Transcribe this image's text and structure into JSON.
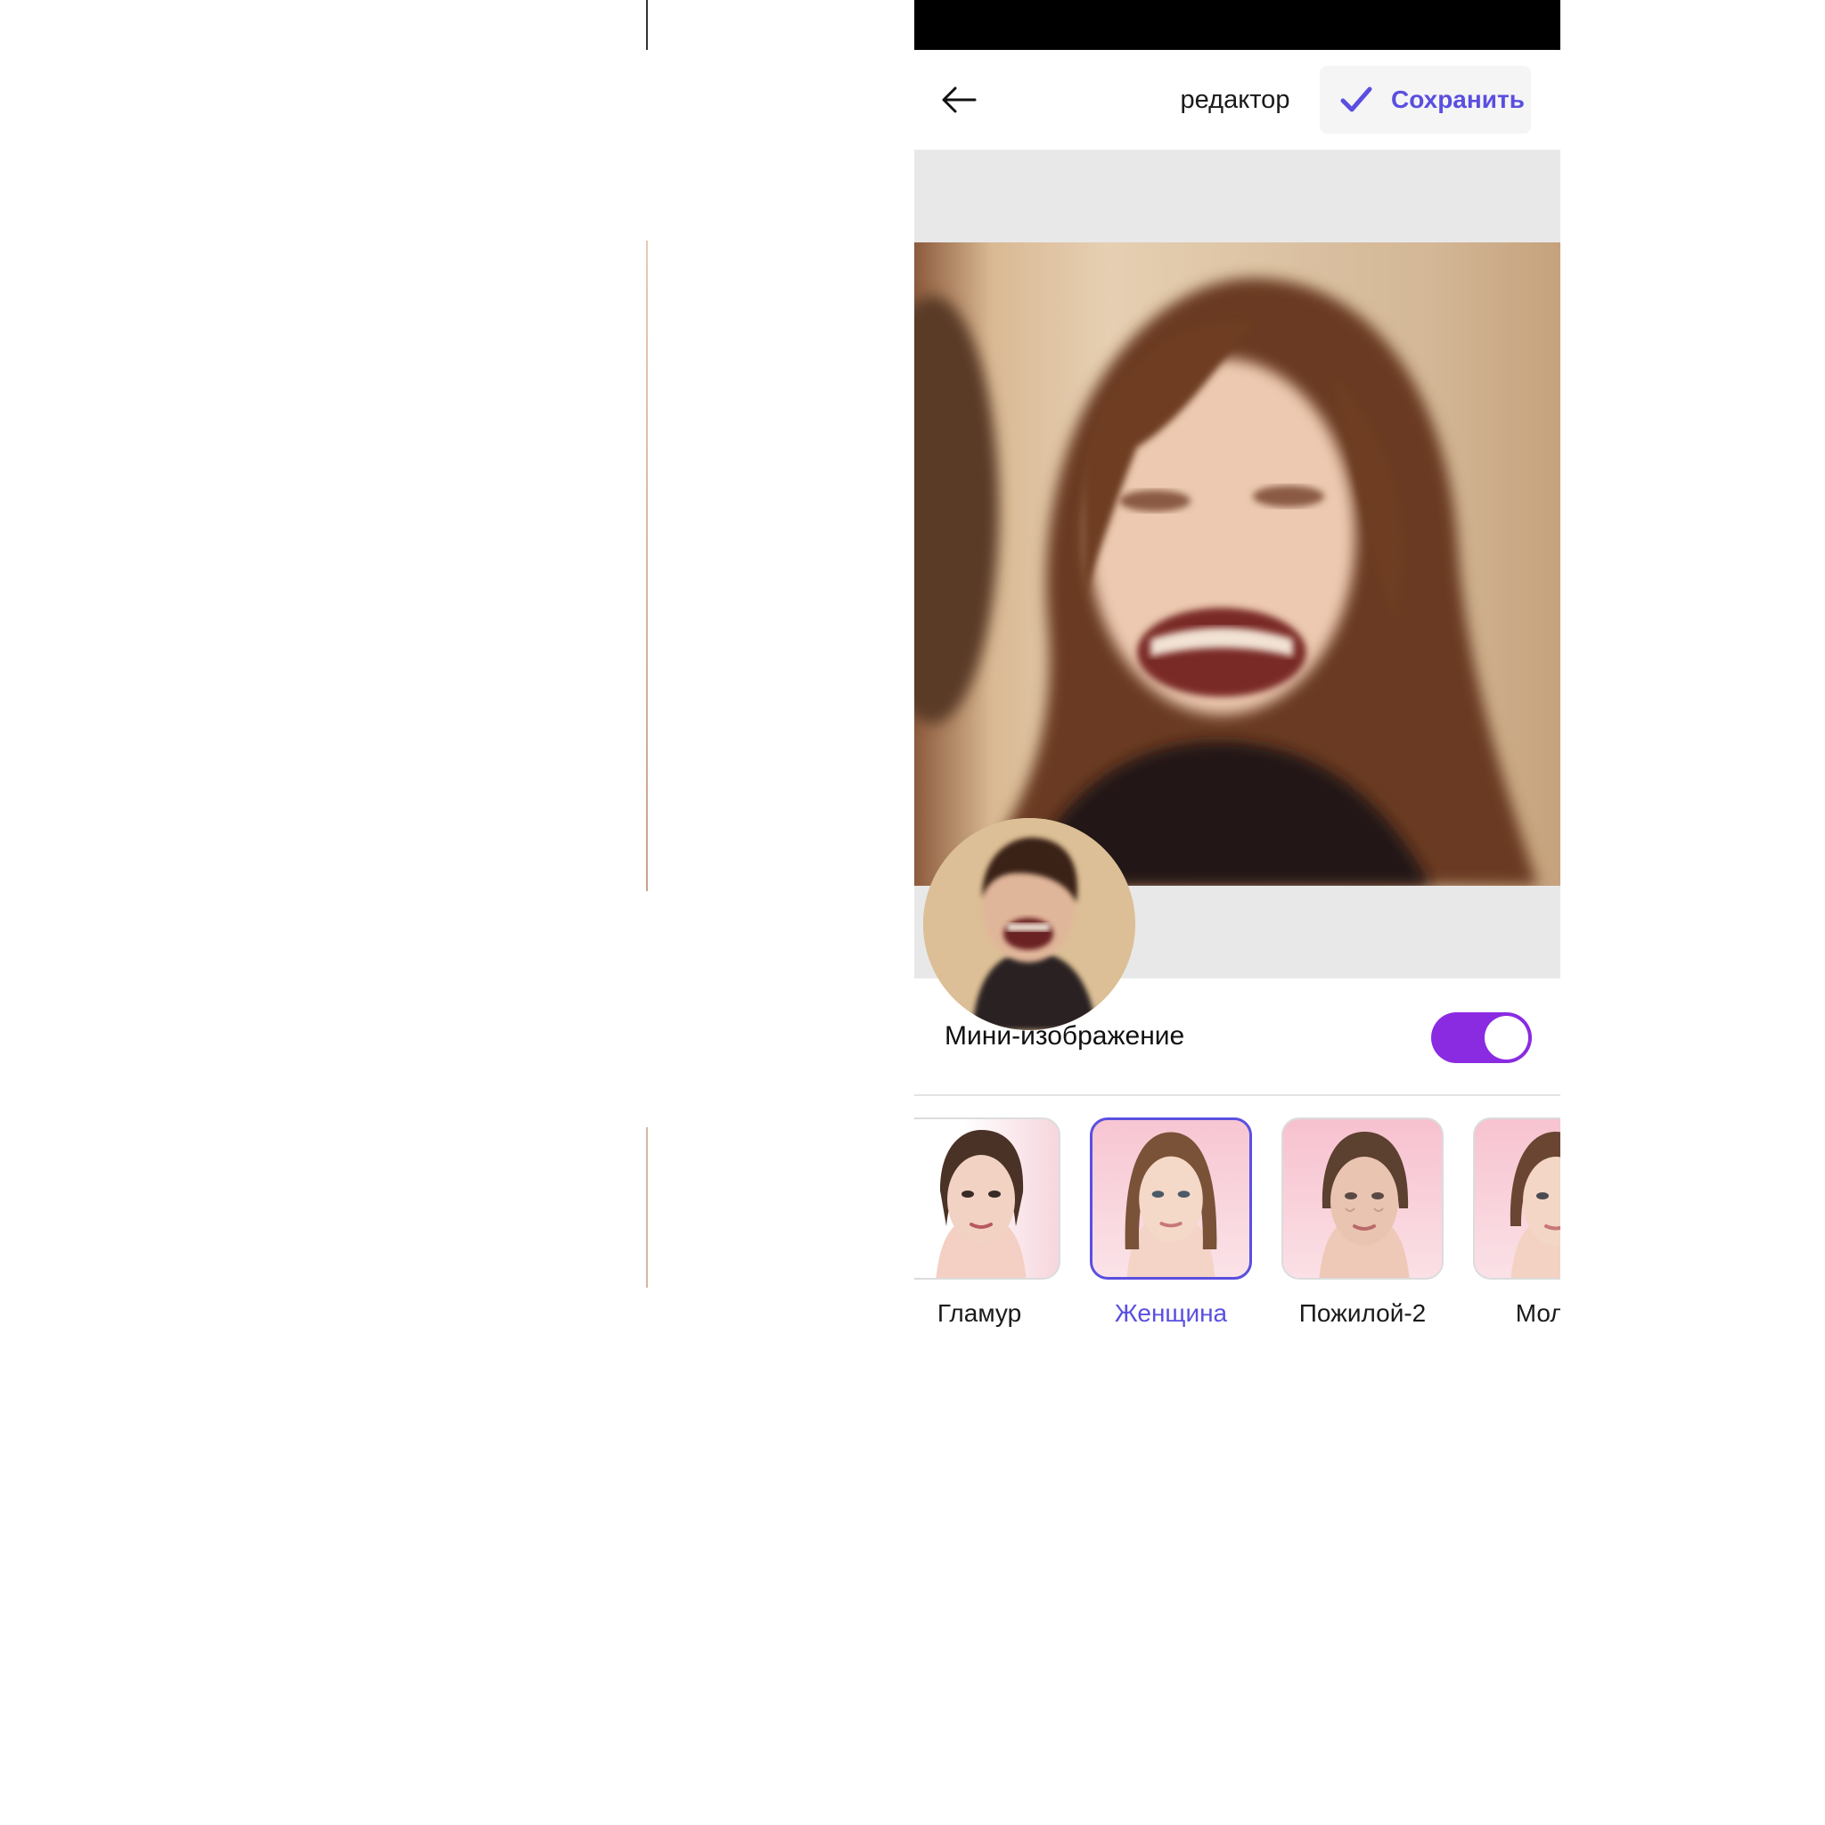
{
  "header": {
    "title": "редактор",
    "save_label": "Сохранить"
  },
  "mini_image": {
    "label": "Мини-изображение",
    "enabled": true
  },
  "filters": [
    {
      "label": "Гламур",
      "selected": false
    },
    {
      "label": "Женщина",
      "selected": true
    },
    {
      "label": "Пожилой-2",
      "selected": false
    },
    {
      "label": "Молод",
      "selected": false
    }
  ],
  "colors": {
    "accent": "#5a4fe0",
    "toggle_on": "#8a2be2",
    "status_bar": "#000000",
    "canvas_bg": "#e8e8e8"
  },
  "icons": {
    "back": "arrow-left-icon",
    "save": "checkmark-icon"
  }
}
